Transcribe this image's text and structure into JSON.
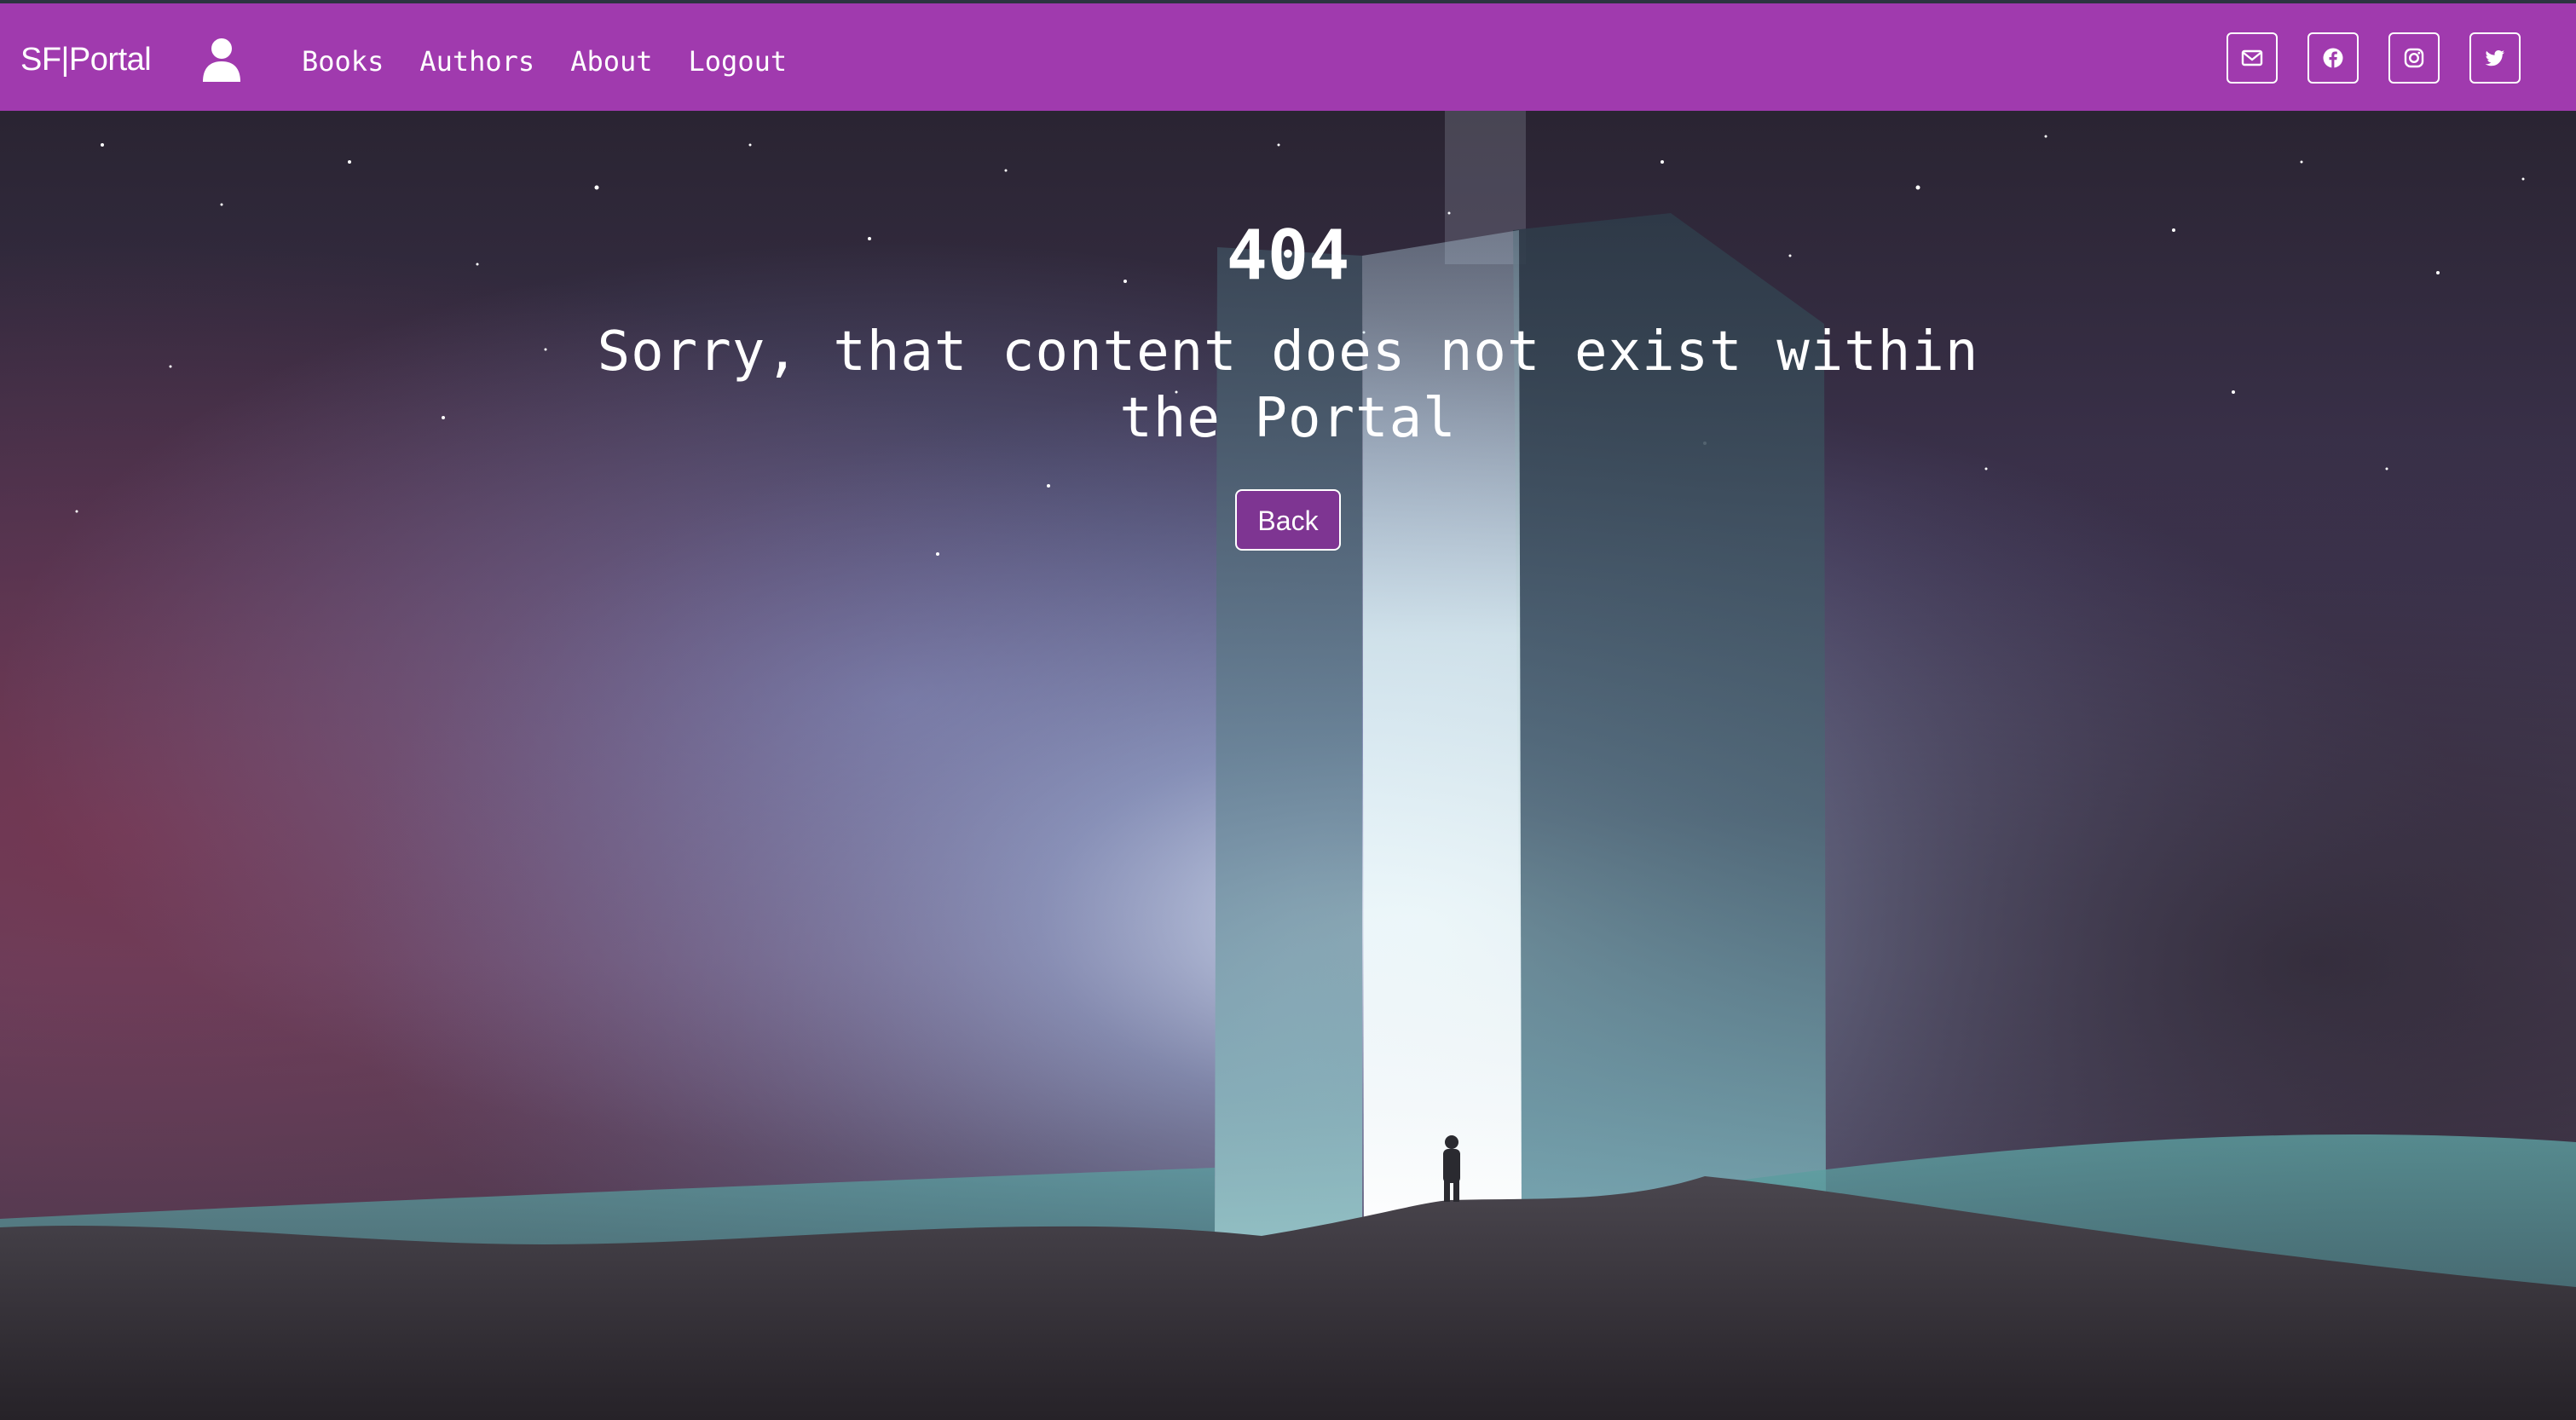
{
  "navbar": {
    "brand": "SF|Portal",
    "links": [
      {
        "label": "Books"
      },
      {
        "label": "Authors"
      },
      {
        "label": "About"
      },
      {
        "label": "Logout"
      }
    ],
    "social": [
      {
        "icon": "mail-icon"
      },
      {
        "icon": "facebook-icon"
      },
      {
        "icon": "instagram-icon"
      },
      {
        "icon": "twitter-icon"
      }
    ]
  },
  "error": {
    "code": "404",
    "message": "Sorry, that content does not exist within the Portal",
    "back_label": "Back"
  },
  "colors": {
    "navbar": "#a03aae",
    "button": "#7e3592",
    "text": "#ffffff"
  }
}
